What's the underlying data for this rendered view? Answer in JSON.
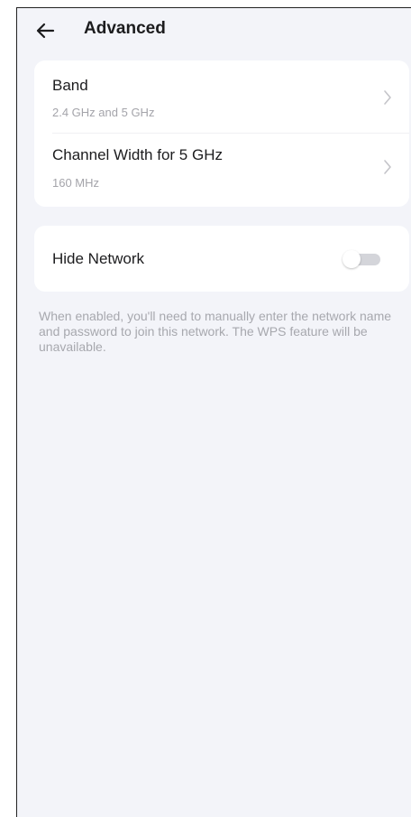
{
  "header": {
    "title": "Advanced",
    "back_icon": "arrow-left-icon"
  },
  "settings": {
    "band": {
      "label": "Band",
      "value": "2.4 GHz and 5 GHz"
    },
    "channel_width": {
      "label": "Channel Width for 5 GHz",
      "value": "160 MHz"
    },
    "chevron_icon": "chevron-right-icon"
  },
  "hide_network": {
    "label": "Hide Network",
    "enabled": false,
    "note": "When enabled, you'll need to manually enter the network name and password to join this network. The WPS feature will be unavailable."
  },
  "colors": {
    "background": "#f3f4f9",
    "card": "#ffffff",
    "primary_text": "#1c1c1e",
    "secondary_text": "#a4a4aa",
    "toggle_off_track": "#d4d5da"
  }
}
